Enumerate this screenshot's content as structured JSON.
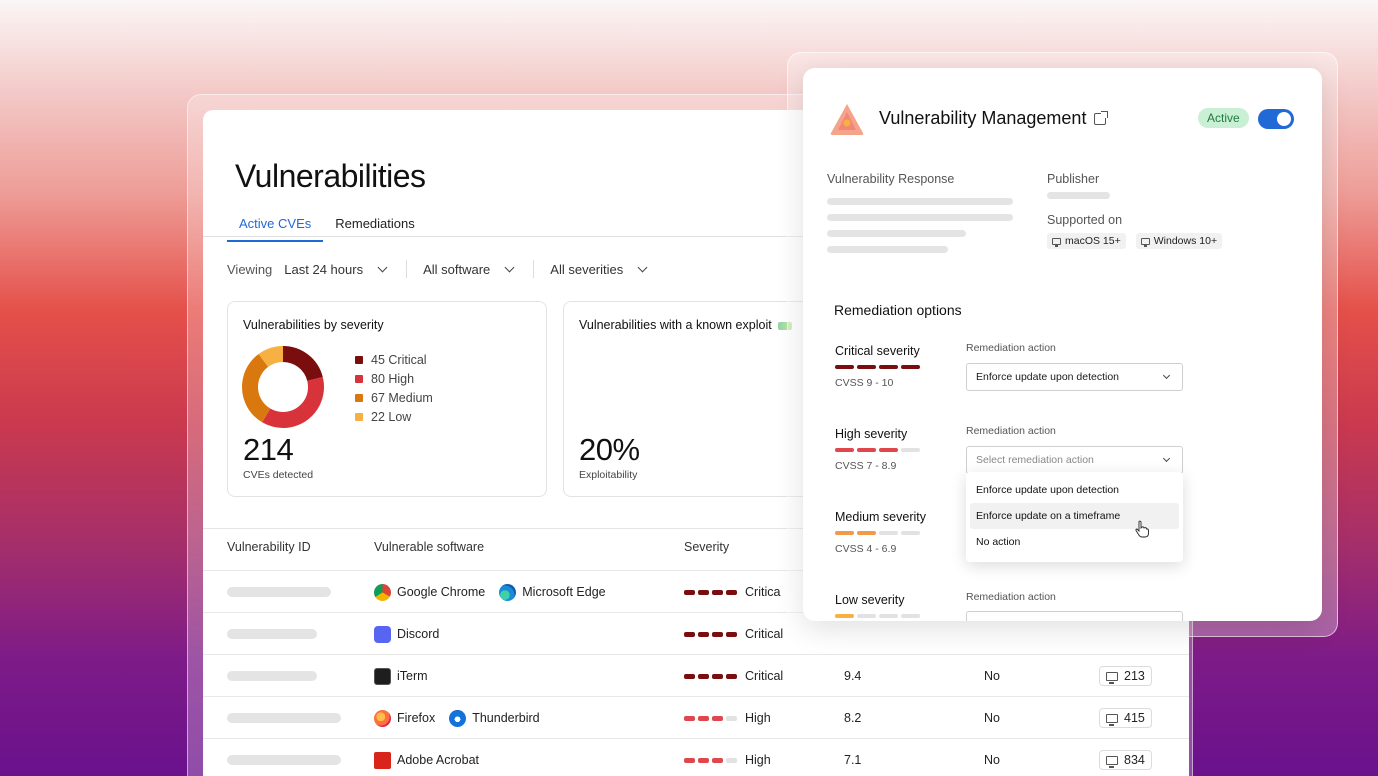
{
  "page": {
    "title": "Vulnerabilities",
    "tabs": [
      {
        "label": "Active CVEs",
        "active": true
      },
      {
        "label": "Remediations",
        "active": false
      }
    ],
    "filters": {
      "viewing_label": "Viewing",
      "time": "Last 24 hours",
      "software": "All software",
      "severity": "All severities"
    }
  },
  "severity_panel": {
    "title": "Vulnerabilities by severity",
    "legend": [
      {
        "label": "45 Critical",
        "count": 45,
        "color": "#7a0d0d"
      },
      {
        "label": "80 High",
        "count": 80,
        "color": "#d8323a"
      },
      {
        "label": "67 Medium",
        "count": 67,
        "color": "#d9780f"
      },
      {
        "label": "22 Low",
        "count": 22,
        "color": "#f7b142"
      }
    ],
    "total": "214",
    "total_label": "CVEs detected"
  },
  "exploit_panel": {
    "title": "Vulnerabilities with a known exploit",
    "value": "20%",
    "value_label": "Exploitability"
  },
  "table": {
    "headers": [
      "Vulnerability ID",
      "Vulnerable software",
      "Severity"
    ],
    "rows": [
      {
        "software": [
          "Google Chrome",
          "Microsoft Edge"
        ],
        "severity": "Critica",
        "bars": 4,
        "level": "critical",
        "score": "",
        "exploit": "",
        "devices": ""
      },
      {
        "software": [
          "Discord"
        ],
        "severity": "Critical",
        "bars": 4,
        "level": "critical",
        "score": "",
        "exploit": "",
        "devices": ""
      },
      {
        "software": [
          "iTerm"
        ],
        "severity": "Critical",
        "bars": 4,
        "level": "critical",
        "score": "9.4",
        "exploit": "No",
        "devices": "213"
      },
      {
        "software": [
          "Firefox",
          "Thunderbird"
        ],
        "severity": "High",
        "bars": 3,
        "level": "high",
        "score": "8.2",
        "exploit": "No",
        "devices": "415"
      },
      {
        "software": [
          "Adobe Acrobat"
        ],
        "severity": "High",
        "bars": 3,
        "level": "high",
        "score": "7.1",
        "exploit": "No",
        "devices": "834"
      }
    ]
  },
  "overlay": {
    "title": "Vulnerability Management",
    "status": "Active",
    "toggle_on": true,
    "category": "Vulnerability Response",
    "publisher_label": "Publisher",
    "supported_label": "Supported on",
    "platforms": [
      "macOS 15+",
      "Windows 10+"
    ],
    "remediation_title": "Remediation options",
    "action_label": "Remediation action",
    "severities": [
      {
        "name": "Critical severity",
        "cvss": "CVSS 9 - 10",
        "level": "critical",
        "filled": 4,
        "action": "Enforce update upon detection",
        "placeholder": false
      },
      {
        "name": "High severity",
        "cvss": "CVSS 7 - 8.9",
        "level": "high",
        "filled": 3,
        "action": "Select remediation action",
        "placeholder": true
      },
      {
        "name": "Medium severity",
        "cvss": "CVSS 4 - 6.9",
        "level": "medium",
        "filled": 2
      },
      {
        "name": "Low severity",
        "cvss": "",
        "level": "low",
        "filled": 1
      }
    ],
    "dropdown_options": [
      "Enforce update upon detection",
      "Enforce update on a timeframe",
      "No action"
    ]
  },
  "colors": {
    "accent": "#2169d6",
    "critical": "#7a0d0d",
    "high": "#e0474c",
    "medium": "#f09a4a",
    "low": "#f7b142",
    "empty_bar": "#e2e2e2"
  }
}
